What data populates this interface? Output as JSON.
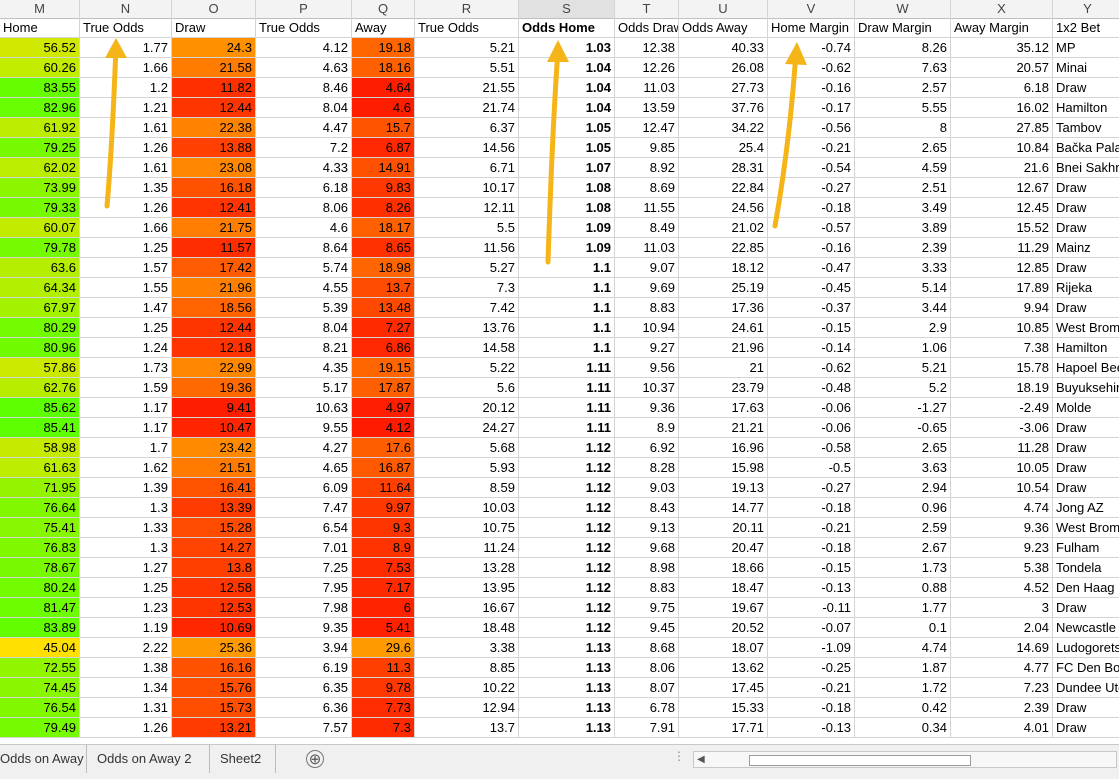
{
  "columns": [
    {
      "letter": "M",
      "header": "Home"
    },
    {
      "letter": "N",
      "header": "True Odds"
    },
    {
      "letter": "O",
      "header": "Draw"
    },
    {
      "letter": "P",
      "header": "True Odds"
    },
    {
      "letter": "Q",
      "header": "Away"
    },
    {
      "letter": "R",
      "header": "True Odds"
    },
    {
      "letter": "S",
      "header": "Odds Home"
    },
    {
      "letter": "T",
      "header": "Odds Draw"
    },
    {
      "letter": "U",
      "header": "Odds Away"
    },
    {
      "letter": "V",
      "header": "Home Margin"
    },
    {
      "letter": "W",
      "header": "Draw Margin"
    },
    {
      "letter": "X",
      "header": "Away Margin"
    },
    {
      "letter": "Y",
      "header": "1x2 Bet"
    }
  ],
  "rows": [
    [
      "56.52",
      "1.77",
      "24.3",
      "4.12",
      "19.18",
      "5.21",
      "1.03",
      "12.38",
      "40.33",
      "-0.74",
      "8.26",
      "35.12",
      "MP"
    ],
    [
      "60.26",
      "1.66",
      "21.58",
      "4.63",
      "18.16",
      "5.51",
      "1.04",
      "12.26",
      "26.08",
      "-0.62",
      "7.63",
      "20.57",
      "Minai"
    ],
    [
      "83.55",
      "1.2",
      "11.82",
      "8.46",
      "4.64",
      "21.55",
      "1.04",
      "11.03",
      "27.73",
      "-0.16",
      "2.57",
      "6.18",
      "Draw"
    ],
    [
      "82.96",
      "1.21",
      "12.44",
      "8.04",
      "4.6",
      "21.74",
      "1.04",
      "13.59",
      "37.76",
      "-0.17",
      "5.55",
      "16.02",
      "Hamilton"
    ],
    [
      "61.92",
      "1.61",
      "22.38",
      "4.47",
      "15.7",
      "6.37",
      "1.05",
      "12.47",
      "34.22",
      "-0.56",
      "8",
      "27.85",
      "Tambov"
    ],
    [
      "79.25",
      "1.26",
      "13.88",
      "7.2",
      "6.87",
      "14.56",
      "1.05",
      "9.85",
      "25.4",
      "-0.21",
      "2.65",
      "10.84",
      "Bačka Palanka"
    ],
    [
      "62.02",
      "1.61",
      "23.08",
      "4.33",
      "14.91",
      "6.71",
      "1.07",
      "8.92",
      "28.31",
      "-0.54",
      "4.59",
      "21.6",
      "Bnei Sakhnin"
    ],
    [
      "73.99",
      "1.35",
      "16.18",
      "6.18",
      "9.83",
      "10.17",
      "1.08",
      "8.69",
      "22.84",
      "-0.27",
      "2.51",
      "12.67",
      "Draw"
    ],
    [
      "79.33",
      "1.26",
      "12.41",
      "8.06",
      "8.26",
      "12.11",
      "1.08",
      "11.55",
      "24.56",
      "-0.18",
      "3.49",
      "12.45",
      "Draw"
    ],
    [
      "60.07",
      "1.66",
      "21.75",
      "4.6",
      "18.17",
      "5.5",
      "1.09",
      "8.49",
      "21.02",
      "-0.57",
      "3.89",
      "15.52",
      "Draw"
    ],
    [
      "79.78",
      "1.25",
      "11.57",
      "8.64",
      "8.65",
      "11.56",
      "1.09",
      "11.03",
      "22.85",
      "-0.16",
      "2.39",
      "11.29",
      "Mainz"
    ],
    [
      "63.6",
      "1.57",
      "17.42",
      "5.74",
      "18.98",
      "5.27",
      "1.1",
      "9.07",
      "18.12",
      "-0.47",
      "3.33",
      "12.85",
      "Draw"
    ],
    [
      "64.34",
      "1.55",
      "21.96",
      "4.55",
      "13.7",
      "7.3",
      "1.1",
      "9.69",
      "25.19",
      "-0.45",
      "5.14",
      "17.89",
      "Rijeka"
    ],
    [
      "67.97",
      "1.47",
      "18.56",
      "5.39",
      "13.48",
      "7.42",
      "1.1",
      "8.83",
      "17.36",
      "-0.37",
      "3.44",
      "9.94",
      "Draw"
    ],
    [
      "80.29",
      "1.25",
      "12.44",
      "8.04",
      "7.27",
      "13.76",
      "1.1",
      "10.94",
      "24.61",
      "-0.15",
      "2.9",
      "10.85",
      "West Brom"
    ],
    [
      "80.96",
      "1.24",
      "12.18",
      "8.21",
      "6.86",
      "14.58",
      "1.1",
      "9.27",
      "21.96",
      "-0.14",
      "1.06",
      "7.38",
      "Hamilton"
    ],
    [
      "57.86",
      "1.73",
      "22.99",
      "4.35",
      "19.15",
      "5.22",
      "1.11",
      "9.56",
      "21",
      "-0.62",
      "5.21",
      "15.78",
      "Hapoel Beer"
    ],
    [
      "62.76",
      "1.59",
      "19.36",
      "5.17",
      "17.87",
      "5.6",
      "1.11",
      "10.37",
      "23.79",
      "-0.48",
      "5.2",
      "18.19",
      "Buyuksehir"
    ],
    [
      "85.62",
      "1.17",
      "9.41",
      "10.63",
      "4.97",
      "20.12",
      "1.11",
      "9.36",
      "17.63",
      "-0.06",
      "-1.27",
      "-2.49",
      "Molde"
    ],
    [
      "85.41",
      "1.17",
      "10.47",
      "9.55",
      "4.12",
      "24.27",
      "1.11",
      "8.9",
      "21.21",
      "-0.06",
      "-0.65",
      "-3.06",
      "Draw"
    ],
    [
      "58.98",
      "1.7",
      "23.42",
      "4.27",
      "17.6",
      "5.68",
      "1.12",
      "6.92",
      "16.96",
      "-0.58",
      "2.65",
      "11.28",
      "Draw"
    ],
    [
      "61.63",
      "1.62",
      "21.51",
      "4.65",
      "16.87",
      "5.93",
      "1.12",
      "8.28",
      "15.98",
      "-0.5",
      "3.63",
      "10.05",
      "Draw"
    ],
    [
      "71.95",
      "1.39",
      "16.41",
      "6.09",
      "11.64",
      "8.59",
      "1.12",
      "9.03",
      "19.13",
      "-0.27",
      "2.94",
      "10.54",
      "Draw"
    ],
    [
      "76.64",
      "1.3",
      "13.39",
      "7.47",
      "9.97",
      "10.03",
      "1.12",
      "8.43",
      "14.77",
      "-0.18",
      "0.96",
      "4.74",
      "Jong AZ"
    ],
    [
      "75.41",
      "1.33",
      "15.28",
      "6.54",
      "9.3",
      "10.75",
      "1.12",
      "9.13",
      "20.11",
      "-0.21",
      "2.59",
      "9.36",
      "West Brom"
    ],
    [
      "76.83",
      "1.3",
      "14.27",
      "7.01",
      "8.9",
      "11.24",
      "1.12",
      "9.68",
      "20.47",
      "-0.18",
      "2.67",
      "9.23",
      "Fulham"
    ],
    [
      "78.67",
      "1.27",
      "13.8",
      "7.25",
      "7.53",
      "13.28",
      "1.12",
      "8.98",
      "18.66",
      "-0.15",
      "1.73",
      "5.38",
      "Tondela"
    ],
    [
      "80.24",
      "1.25",
      "12.58",
      "7.95",
      "7.17",
      "13.95",
      "1.12",
      "8.83",
      "18.47",
      "-0.13",
      "0.88",
      "4.52",
      "Den Haag"
    ],
    [
      "81.47",
      "1.23",
      "12.53",
      "7.98",
      "6",
      "16.67",
      "1.12",
      "9.75",
      "19.67",
      "-0.11",
      "1.77",
      "3",
      "Draw"
    ],
    [
      "83.89",
      "1.19",
      "10.69",
      "9.35",
      "5.41",
      "18.48",
      "1.12",
      "9.45",
      "20.52",
      "-0.07",
      "0.1",
      "2.04",
      "Newcastle"
    ],
    [
      "45.04",
      "2.22",
      "25.36",
      "3.94",
      "29.6",
      "3.38",
      "1.13",
      "8.68",
      "18.07",
      "-1.09",
      "4.74",
      "14.69",
      "Ludogorets"
    ],
    [
      "72.55",
      "1.38",
      "16.16",
      "6.19",
      "11.3",
      "8.85",
      "1.13",
      "8.06",
      "13.62",
      "-0.25",
      "1.87",
      "4.77",
      "FC Den Bosch"
    ],
    [
      "74.45",
      "1.34",
      "15.76",
      "6.35",
      "9.78",
      "10.22",
      "1.13",
      "8.07",
      "17.45",
      "-0.21",
      "1.72",
      "7.23",
      "Dundee Utd"
    ],
    [
      "76.54",
      "1.31",
      "15.73",
      "6.36",
      "7.73",
      "12.94",
      "1.13",
      "6.78",
      "15.33",
      "-0.18",
      "0.42",
      "2.39",
      "Draw"
    ],
    [
      "79.49",
      "1.26",
      "13.21",
      "7.57",
      "7.3",
      "13.7",
      "1.13",
      "7.91",
      "17.71",
      "-0.13",
      "0.34",
      "4.01",
      "Draw"
    ]
  ],
  "tabs": [
    "Odds on Away",
    "Odds on Away 2",
    "Sheet2"
  ],
  "add_sheet_label": "⊕",
  "scroll_dots": "⋮",
  "scroll_left_arrow": "◀",
  "colors": {
    "arrow": "#f5b417",
    "grid": "#d4d4d4",
    "header_bg": "#f3f3f3",
    "home_scale": [
      "#ffe000",
      "#5cff00"
    ],
    "draw_away_scale": [
      "#ff1a00",
      "#ff9a00"
    ]
  }
}
